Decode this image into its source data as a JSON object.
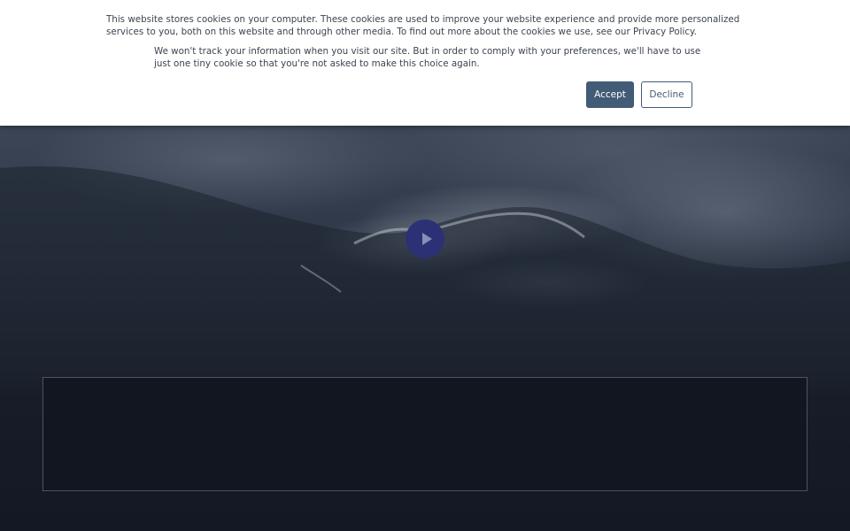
{
  "cookie_banner": {
    "message": "This website stores cookies on your computer. These cookies are used to improve your website experience and provide more personalized services to you, both on this website and through other media. To find out more about the cookies we use, see our Privacy Policy.",
    "notice": "We won't track your information when you visit our site. But in order to comply with your preferences, we'll have to use just one tiny cookie so that you're not asked to make this choice again.",
    "accept_label": "Accept",
    "decline_label": "Decline"
  },
  "video": {
    "play_icon": "play-icon"
  },
  "colors": {
    "accent": "#425b76",
    "play_button": "#2b3174",
    "page_background": "#141824"
  }
}
